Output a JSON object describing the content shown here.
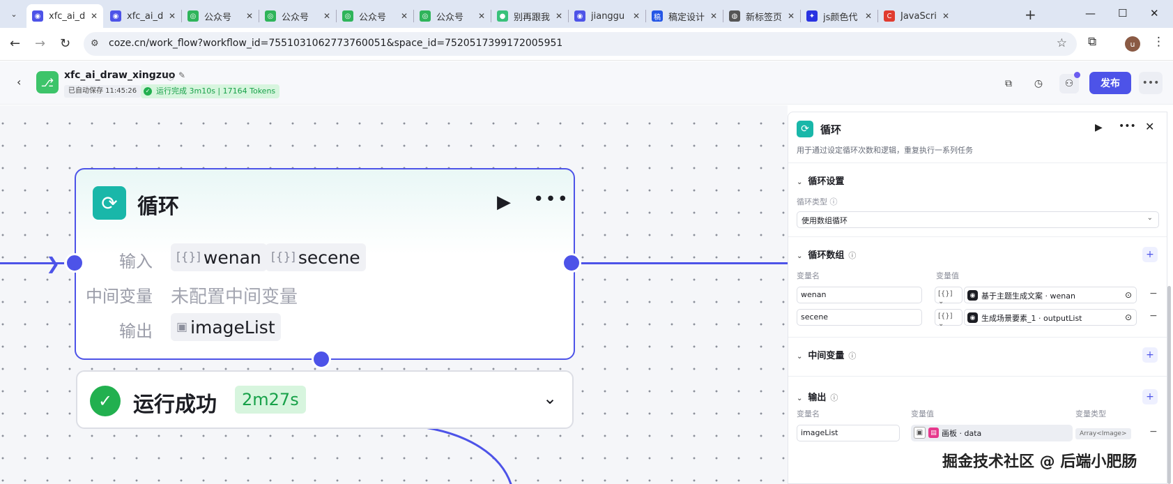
{
  "browser": {
    "tabs": [
      {
        "title": "xfc_ai_d",
        "favicon": "coze-icon",
        "active": true
      },
      {
        "title": "xfc_ai_d",
        "favicon": "coze-icon"
      },
      {
        "title": "公众号",
        "favicon": "wechat-icon"
      },
      {
        "title": "公众号",
        "favicon": "wechat-icon"
      },
      {
        "title": "公众号",
        "favicon": "wechat-icon"
      },
      {
        "title": "公众号",
        "favicon": "wechat-icon"
      },
      {
        "title": "别再跟我",
        "favicon": "juejin-icon"
      },
      {
        "title": "jianggu",
        "favicon": "coze-icon"
      },
      {
        "title": "稿定设计",
        "favicon": "gaoding-icon"
      },
      {
        "title": "新标签页",
        "favicon": "chrome-icon"
      },
      {
        "title": "js颜色代",
        "favicon": "baidu-icon"
      },
      {
        "title": "JavaScri",
        "favicon": "csdn-icon"
      }
    ],
    "url": "coze.cn/work_flow?workflow_id=7551031062773760051&space_id=7520517399172005951",
    "avatar_letter": "u"
  },
  "header": {
    "workflow_name": "xfc_ai_draw_xingzuo",
    "autosave": "已自动保存 11:45:26",
    "run_status": "运行完成 3m10s | 17164 Tokens",
    "publish_label": "发布"
  },
  "node": {
    "title": "循环",
    "input_label": "输入",
    "inputs": [
      "wenan",
      "secene"
    ],
    "mid_label": "中间变量",
    "mid_value": "未配置中间变量",
    "output_label": "输出",
    "output": "imageList",
    "result_text": "运行成功",
    "result_time": "2m27s"
  },
  "panel": {
    "title": "循环",
    "description": "用于通过设定循环次数和逻辑，重复执行一系列任务",
    "loop_settings": "循环设置",
    "loop_type_label": "循环类型",
    "loop_type_value": "使用数组循环",
    "loop_array": "循环数组",
    "var_name_header": "变量名",
    "var_value_header": "变量值",
    "var_type_header": "变量类型",
    "array_rows": [
      {
        "name": "wenan",
        "type": "[{}]",
        "ref": "基于主题生成文案 · wenan"
      },
      {
        "name": "secene",
        "type": "[{}]",
        "ref": "生成场景要素_1 · outputList"
      }
    ],
    "mid_vars": "中间变量",
    "output": "输出",
    "output_row": {
      "name": "imageList",
      "ref": "画板 · data",
      "type": "Array<Image>"
    }
  },
  "watermark": "掘金技术社区 @ 后端小肥肠",
  "colors": {
    "accent": "#4d53e8",
    "success": "#22b04f",
    "loop_teal": "#19b7a9"
  }
}
